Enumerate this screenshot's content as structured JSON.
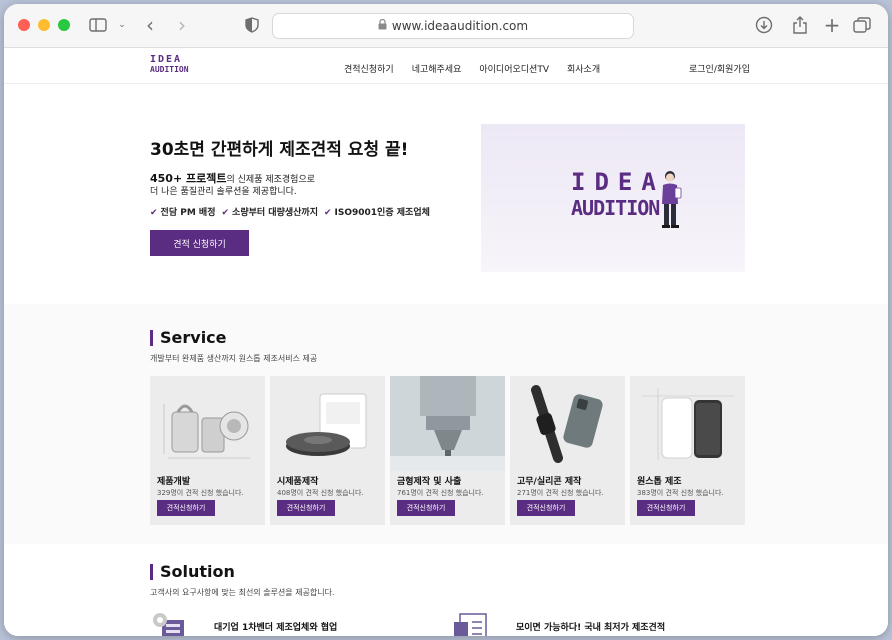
{
  "browser": {
    "url": "www.ideaaudition.com"
  },
  "site": {
    "logo_line1": "IDEA",
    "logo_line2": "AUDITION",
    "nav": [
      "견적신청하기",
      "네고해주세요",
      "아이디어오디션TV",
      "회사소개"
    ],
    "login": "로그인/회원가입"
  },
  "hero": {
    "title": "30초면 간편하게 제조견적 요청 끝!",
    "sub1_bold": "450+ 프로젝트",
    "sub1_rest": "의 신제품 제조경험으로",
    "sub2": "더 나은 품질관리 솔루션을 제공합니다.",
    "checks": [
      "전담 PM 배정",
      "소량부터 대량생산까지",
      "ISO9001인증 제조업체"
    ],
    "button": "견적 신청하기",
    "image_logo_line1": "IDEA",
    "image_logo_line2": "AUDITION"
  },
  "service": {
    "title": "Service",
    "desc": "개발부터 완제품 생산까지 원스톱 제조서비스 제공",
    "cards": [
      {
        "title": "제품개발",
        "count": "329명이 견적 신청 했습니다.",
        "button": "견적신청하기",
        "icon": "product-dev-icon"
      },
      {
        "title": "시제품제작",
        "count": "408명이 견적 신청 했습니다.",
        "button": "견적신청하기",
        "icon": "prototype-icon"
      },
      {
        "title": "금형제작 및 사출",
        "count": "761명이 견적 신청 했습니다.",
        "button": "견적신청하기",
        "icon": "mold-icon"
      },
      {
        "title": "고무/실리콘 제작",
        "count": "271명이 견적 신청 했습니다.",
        "button": "견적신청하기",
        "icon": "silicone-icon"
      },
      {
        "title": "원스톱 제조",
        "count": "383명이 견적 신청 했습니다.",
        "button": "견적신청하기",
        "icon": "onestop-icon"
      }
    ]
  },
  "solution": {
    "title": "Solution",
    "desc": "고객사의 요구사항에 맞는 최선의 솔루션을 제공합니다.",
    "items": [
      {
        "title": "대기업 1차벤더 제조업체와 협업",
        "icon": "factory-icon"
      },
      {
        "title": "모이면 가능하다! 국내 최저가 제조견적",
        "icon": "document-icon"
      }
    ]
  },
  "colors": {
    "brand": "#5a2d82"
  }
}
